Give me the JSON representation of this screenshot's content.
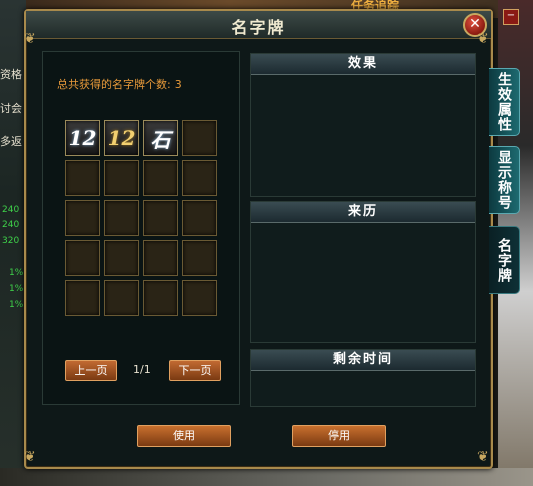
{
  "background": {
    "quest_text": "任务追踪",
    "left_texts": [
      "资格",
      "讨会",
      "多返"
    ],
    "left_numbers": [
      "240",
      "240",
      "320",
      "1%",
      "1%",
      "1%"
    ]
  },
  "window": {
    "title": "名字牌",
    "close_symbol": "✕"
  },
  "nameplates": {
    "count_label": "总共获得的名字牌个数:",
    "count_value": "3",
    "slots": [
      {
        "glyph": "12",
        "filled": true,
        "style": "silver"
      },
      {
        "glyph": "12",
        "filled": true,
        "style": "gold"
      },
      {
        "glyph": "石",
        "filled": true,
        "style": "silver"
      },
      {
        "glyph": "",
        "filled": false
      },
      {
        "glyph": "",
        "filled": false
      },
      {
        "glyph": "",
        "filled": false
      },
      {
        "glyph": "",
        "filled": false
      },
      {
        "glyph": "",
        "filled": false
      },
      {
        "glyph": "",
        "filled": false
      },
      {
        "glyph": "",
        "filled": false
      },
      {
        "glyph": "",
        "filled": false
      },
      {
        "glyph": "",
        "filled": false
      },
      {
        "glyph": "",
        "filled": false
      },
      {
        "glyph": "",
        "filled": false
      },
      {
        "glyph": "",
        "filled": false
      },
      {
        "glyph": "",
        "filled": false
      },
      {
        "glyph": "",
        "filled": false
      },
      {
        "glyph": "",
        "filled": false
      },
      {
        "glyph": "",
        "filled": false
      },
      {
        "glyph": "",
        "filled": false
      }
    ],
    "prev_label": "上一页",
    "next_label": "下一页",
    "page_indicator": "1/1"
  },
  "sections": {
    "effect": "效果",
    "origin": "来历",
    "remaining_time": "剩余时间"
  },
  "actions": {
    "use_label": "使用",
    "disable_label": "停用"
  },
  "side_tabs": [
    {
      "label": "生效属性",
      "active": false
    },
    {
      "label": "显示称号",
      "active": false
    },
    {
      "label": "名字牌",
      "active": true
    }
  ],
  "colors": {
    "accent_orange": "#e89a3a",
    "frame_gold": "#a88a4c",
    "panel_bg": "#0e1818",
    "tab_teal": "#1d6a70"
  }
}
